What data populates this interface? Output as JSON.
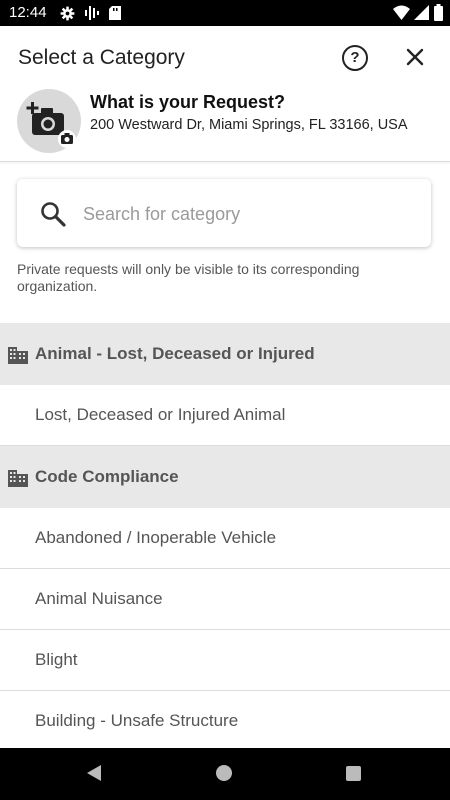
{
  "status_bar": {
    "time": "12:44",
    "icons": [
      "gear-icon",
      "signal-bars-icon",
      "sd-card-icon",
      "wifi-icon",
      "cell-signal-icon",
      "battery-icon"
    ]
  },
  "header": {
    "title": "Select a Category",
    "help_icon": "question-circle-icon",
    "close_icon": "close-icon"
  },
  "request": {
    "title": "What is your Request?",
    "address": "200 Westward Dr, Miami Springs, FL 33166, USA",
    "photo_icon": "add-photo-icon"
  },
  "search": {
    "placeholder": "Search for category",
    "value": ""
  },
  "privacy_note": "Private requests will only be visible to its corresponding organization.",
  "categories": [
    {
      "group": "Animal - Lost, Deceased or Injured",
      "items": [
        "Lost, Deceased or Injured Animal"
      ]
    },
    {
      "group": "Code Compliance",
      "items": [
        "Abandoned / Inoperable Vehicle",
        "Animal Nuisance",
        "Blight",
        "Building - Unsafe Structure"
      ]
    }
  ],
  "colors": {
    "group_bg": "#e8e8e8",
    "text_secondary": "#555555",
    "status_bar": "#000000"
  }
}
